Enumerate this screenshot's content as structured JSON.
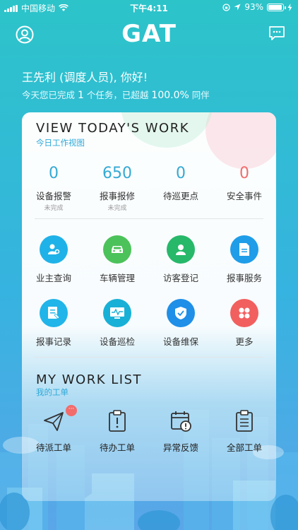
{
  "status_bar": {
    "carrier": "中国移动",
    "time": "下午4:11",
    "battery_percent": "93%",
    "battery_level": 0.93
  },
  "header": {
    "logo": "GAT"
  },
  "greeting": "王先利 (调度人员), 你好!",
  "summary": {
    "prefix": "今天您已完成",
    "count": "1",
    "middle": "个任务，已超越",
    "percent": "100.0%",
    "suffix": "同伴"
  },
  "today": {
    "title": "VIEW TODAY'S WORK",
    "subtitle": "今日工作视图",
    "stats": [
      {
        "value": "0",
        "label": "设备报警",
        "note": "未完成"
      },
      {
        "value": "650",
        "label": "报事报修",
        "note": "未完成"
      },
      {
        "value": "0",
        "label": "待巡更点",
        "note": ""
      },
      {
        "value": "0",
        "label": "安全事件",
        "note": ""
      }
    ],
    "functions": [
      {
        "label": "业主查询",
        "icon": "owner-icon",
        "color": "#1fb2e8"
      },
      {
        "label": "车辆管理",
        "icon": "car-icon",
        "color": "#4cc25a"
      },
      {
        "label": "访客登记",
        "icon": "visitor-icon",
        "color": "#27b86a"
      },
      {
        "label": "报事服务",
        "icon": "document-icon",
        "color": "#1f9de8"
      },
      {
        "label": "报事记录",
        "icon": "record-icon",
        "color": "#21b5e9"
      },
      {
        "label": "设备巡检",
        "icon": "monitor-icon",
        "color": "#18b0d6"
      },
      {
        "label": "设备维保",
        "icon": "shield-icon",
        "color": "#1f8fe8"
      },
      {
        "label": "更多",
        "icon": "more-icon",
        "color": "#f25f5f"
      }
    ]
  },
  "work_list": {
    "title": "MY WORK LIST",
    "subtitle": "我的工单",
    "items": [
      {
        "label": "待派工单",
        "icon": "send-icon",
        "badge": "···"
      },
      {
        "label": "待办工单",
        "icon": "clipboard-icon"
      },
      {
        "label": "异常反馈",
        "icon": "calendar-alert-icon"
      },
      {
        "label": "全部工单",
        "icon": "list-icon"
      }
    ]
  }
}
